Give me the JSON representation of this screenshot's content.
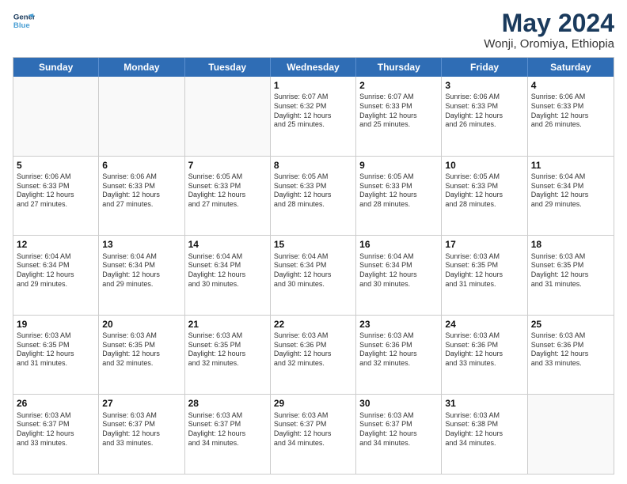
{
  "logo": {
    "line1": "General",
    "line2": "Blue"
  },
  "title": "May 2024",
  "subtitle": "Wonji, Oromiya, Ethiopia",
  "headers": [
    "Sunday",
    "Monday",
    "Tuesday",
    "Wednesday",
    "Thursday",
    "Friday",
    "Saturday"
  ],
  "weeks": [
    [
      {
        "day": "",
        "info": ""
      },
      {
        "day": "",
        "info": ""
      },
      {
        "day": "",
        "info": ""
      },
      {
        "day": "1",
        "info": "Sunrise: 6:07 AM\nSunset: 6:32 PM\nDaylight: 12 hours\nand 25 minutes."
      },
      {
        "day": "2",
        "info": "Sunrise: 6:07 AM\nSunset: 6:33 PM\nDaylight: 12 hours\nand 25 minutes."
      },
      {
        "day": "3",
        "info": "Sunrise: 6:06 AM\nSunset: 6:33 PM\nDaylight: 12 hours\nand 26 minutes."
      },
      {
        "day": "4",
        "info": "Sunrise: 6:06 AM\nSunset: 6:33 PM\nDaylight: 12 hours\nand 26 minutes."
      }
    ],
    [
      {
        "day": "5",
        "info": "Sunrise: 6:06 AM\nSunset: 6:33 PM\nDaylight: 12 hours\nand 27 minutes."
      },
      {
        "day": "6",
        "info": "Sunrise: 6:06 AM\nSunset: 6:33 PM\nDaylight: 12 hours\nand 27 minutes."
      },
      {
        "day": "7",
        "info": "Sunrise: 6:05 AM\nSunset: 6:33 PM\nDaylight: 12 hours\nand 27 minutes."
      },
      {
        "day": "8",
        "info": "Sunrise: 6:05 AM\nSunset: 6:33 PM\nDaylight: 12 hours\nand 28 minutes."
      },
      {
        "day": "9",
        "info": "Sunrise: 6:05 AM\nSunset: 6:33 PM\nDaylight: 12 hours\nand 28 minutes."
      },
      {
        "day": "10",
        "info": "Sunrise: 6:05 AM\nSunset: 6:33 PM\nDaylight: 12 hours\nand 28 minutes."
      },
      {
        "day": "11",
        "info": "Sunrise: 6:04 AM\nSunset: 6:34 PM\nDaylight: 12 hours\nand 29 minutes."
      }
    ],
    [
      {
        "day": "12",
        "info": "Sunrise: 6:04 AM\nSunset: 6:34 PM\nDaylight: 12 hours\nand 29 minutes."
      },
      {
        "day": "13",
        "info": "Sunrise: 6:04 AM\nSunset: 6:34 PM\nDaylight: 12 hours\nand 29 minutes."
      },
      {
        "day": "14",
        "info": "Sunrise: 6:04 AM\nSunset: 6:34 PM\nDaylight: 12 hours\nand 30 minutes."
      },
      {
        "day": "15",
        "info": "Sunrise: 6:04 AM\nSunset: 6:34 PM\nDaylight: 12 hours\nand 30 minutes."
      },
      {
        "day": "16",
        "info": "Sunrise: 6:04 AM\nSunset: 6:34 PM\nDaylight: 12 hours\nand 30 minutes."
      },
      {
        "day": "17",
        "info": "Sunrise: 6:03 AM\nSunset: 6:35 PM\nDaylight: 12 hours\nand 31 minutes."
      },
      {
        "day": "18",
        "info": "Sunrise: 6:03 AM\nSunset: 6:35 PM\nDaylight: 12 hours\nand 31 minutes."
      }
    ],
    [
      {
        "day": "19",
        "info": "Sunrise: 6:03 AM\nSunset: 6:35 PM\nDaylight: 12 hours\nand 31 minutes."
      },
      {
        "day": "20",
        "info": "Sunrise: 6:03 AM\nSunset: 6:35 PM\nDaylight: 12 hours\nand 32 minutes."
      },
      {
        "day": "21",
        "info": "Sunrise: 6:03 AM\nSunset: 6:35 PM\nDaylight: 12 hours\nand 32 minutes."
      },
      {
        "day": "22",
        "info": "Sunrise: 6:03 AM\nSunset: 6:36 PM\nDaylight: 12 hours\nand 32 minutes."
      },
      {
        "day": "23",
        "info": "Sunrise: 6:03 AM\nSunset: 6:36 PM\nDaylight: 12 hours\nand 32 minutes."
      },
      {
        "day": "24",
        "info": "Sunrise: 6:03 AM\nSunset: 6:36 PM\nDaylight: 12 hours\nand 33 minutes."
      },
      {
        "day": "25",
        "info": "Sunrise: 6:03 AM\nSunset: 6:36 PM\nDaylight: 12 hours\nand 33 minutes."
      }
    ],
    [
      {
        "day": "26",
        "info": "Sunrise: 6:03 AM\nSunset: 6:37 PM\nDaylight: 12 hours\nand 33 minutes."
      },
      {
        "day": "27",
        "info": "Sunrise: 6:03 AM\nSunset: 6:37 PM\nDaylight: 12 hours\nand 33 minutes."
      },
      {
        "day": "28",
        "info": "Sunrise: 6:03 AM\nSunset: 6:37 PM\nDaylight: 12 hours\nand 34 minutes."
      },
      {
        "day": "29",
        "info": "Sunrise: 6:03 AM\nSunset: 6:37 PM\nDaylight: 12 hours\nand 34 minutes."
      },
      {
        "day": "30",
        "info": "Sunrise: 6:03 AM\nSunset: 6:37 PM\nDaylight: 12 hours\nand 34 minutes."
      },
      {
        "day": "31",
        "info": "Sunrise: 6:03 AM\nSunset: 6:38 PM\nDaylight: 12 hours\nand 34 minutes."
      },
      {
        "day": "",
        "info": ""
      }
    ]
  ]
}
